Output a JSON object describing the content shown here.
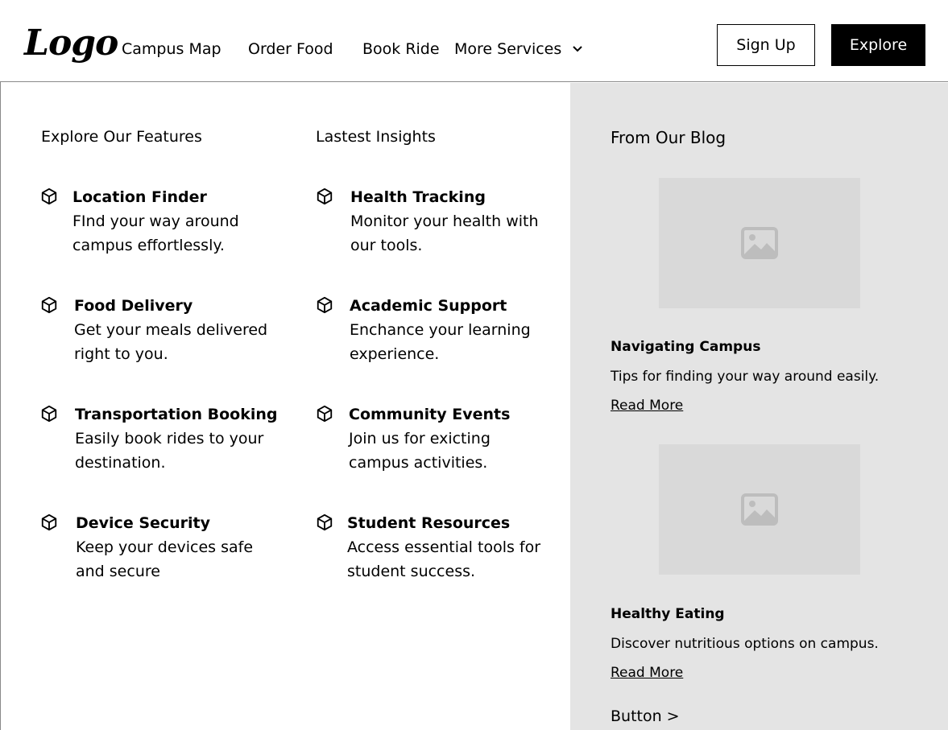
{
  "header": {
    "logo_text": "Logo",
    "nav": [
      {
        "label": "Campus Map"
      },
      {
        "label": "Order Food"
      },
      {
        "label": "Book Ride"
      },
      {
        "label": "More Services"
      }
    ],
    "signup_label": "Sign Up",
    "explore_label": "Explore"
  },
  "features": {
    "title": "Explore Our Features",
    "items": [
      {
        "icon": "cube-icon",
        "title": "Location Finder",
        "desc": "FInd your way around campus effortlessly."
      },
      {
        "icon": "cube-icon",
        "title": "Food Delivery",
        "desc": "Get your meals delivered right to you."
      },
      {
        "icon": "cube-icon",
        "title": "Transportation Booking",
        "desc": "Easily book rides to your destination."
      },
      {
        "icon": "cube-icon",
        "title": "Device Security",
        "desc": "Keep your devices safe and secure"
      }
    ]
  },
  "insights": {
    "title": "Lastest Insights",
    "items": [
      {
        "icon": "cube-icon",
        "title": "Health Tracking",
        "desc": "Monitor your health with our tools."
      },
      {
        "icon": "cube-icon",
        "title": "Academic Support",
        "desc": "Enchance your learning experience."
      },
      {
        "icon": "cube-icon",
        "title": "Community Events",
        "desc": "Join us for exicting campus activities."
      },
      {
        "icon": "cube-icon",
        "title": "Student Resources",
        "desc": "Access essential tools for student success."
      }
    ]
  },
  "blog": {
    "title": "From Our Blog",
    "posts": [
      {
        "image_icon": "image-placeholder-icon",
        "title": "Navigating Campus",
        "desc": "Tips for finding your way around easily.",
        "link": "Read More"
      },
      {
        "image_icon": "image-placeholder-icon",
        "title": "Healthy Eating",
        "desc": "Discover nutritious options on campus.",
        "link": "Read More"
      }
    ],
    "button_label": "Button >"
  },
  "colors": {
    "explore_button_bg": "#000000",
    "blog_panel_bg": "#e4e4e4",
    "image_placeholder_bg": "#d9d9d9",
    "image_icon_color": "#bdbdbd"
  }
}
